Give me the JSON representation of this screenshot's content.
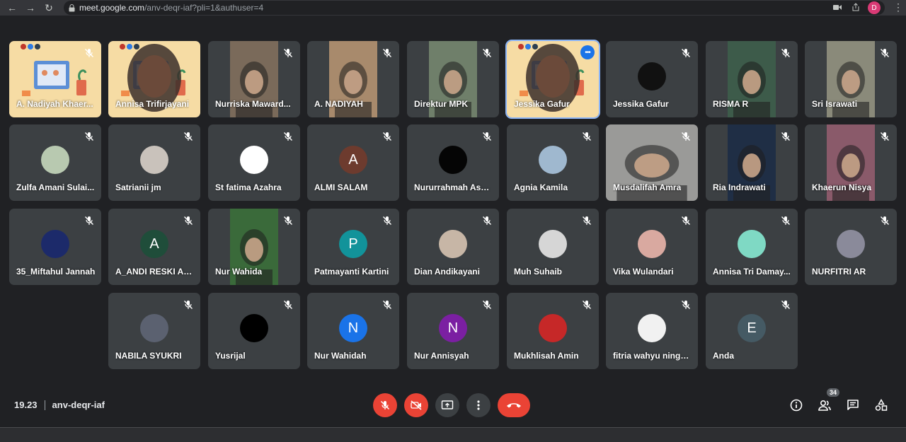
{
  "browser": {
    "url_host": "meet.google.com",
    "url_path": "/anv-deqr-iaf?pli=1&authuser=4",
    "profile_initial": "D",
    "icons": [
      "back-icon",
      "forward-icon",
      "reload-icon",
      "lock-icon",
      "camera-icon",
      "share-icon",
      "star-icon",
      "menu-icon"
    ]
  },
  "participants": [
    {
      "name": "A. Nadiyah Khaer...",
      "kind": "screen",
      "muted": true
    },
    {
      "name": "Annisa Trifirjayani",
      "kind": "screen-cam",
      "muted": false
    },
    {
      "name": "Nurriska Maward...",
      "kind": "video",
      "muted": true,
      "tone": "#7a6a5a"
    },
    {
      "name": "A. NADIYAH",
      "kind": "video",
      "muted": true,
      "tone": "#a88a6c"
    },
    {
      "name": "Direktur MPK",
      "kind": "video",
      "muted": true,
      "tone": "#6f7f6a"
    },
    {
      "name": "Jessika Gafur",
      "kind": "screen-cam",
      "muted": false,
      "active": true,
      "more": "•••"
    },
    {
      "name": "Jessika Gafur",
      "kind": "avatar",
      "muted": true,
      "color": "#111111",
      "initial": ""
    },
    {
      "name": "RISMA R",
      "kind": "video",
      "muted": true,
      "tone": "#3d5b4a"
    },
    {
      "name": "Sri Israwati",
      "kind": "video",
      "muted": true,
      "tone": "#8a8a7a"
    },
    {
      "name": "Zulfa Amani Sulai...",
      "kind": "avatar",
      "muted": true,
      "color": "#b8c9b0",
      "initial": ""
    },
    {
      "name": "Satrianii jm",
      "kind": "avatar",
      "muted": true,
      "color": "#c9c2bb",
      "initial": ""
    },
    {
      "name": "St fatima Azahra",
      "kind": "avatar",
      "muted": true,
      "color": "#ffffff",
      "initial": ""
    },
    {
      "name": "ALMI SALAM",
      "kind": "avatar",
      "muted": true,
      "color": "#6d3b2e",
      "initial": "A"
    },
    {
      "name": "Nururrahmah Ashar",
      "kind": "avatar",
      "muted": true,
      "color": "#050505",
      "initial": ""
    },
    {
      "name": "Agnia Kamila",
      "kind": "avatar",
      "muted": true,
      "color": "#9fb8cf",
      "initial": ""
    },
    {
      "name": "Musdalifah Amra",
      "kind": "video",
      "muted": true,
      "wide": true,
      "tone": "#9a9a98"
    },
    {
      "name": "Ria Indrawati",
      "kind": "video",
      "muted": true,
      "tone": "#1f2e45"
    },
    {
      "name": "Khaerun Nisya",
      "kind": "video",
      "muted": true,
      "tone": "#8a5a6a"
    },
    {
      "name": "35_Miftahul Jannah",
      "kind": "avatar",
      "muted": true,
      "color": "#1c2a6a",
      "initial": ""
    },
    {
      "name": "A_ANDI RESKI AN...",
      "kind": "avatar",
      "muted": true,
      "color": "#1f4d3a",
      "initial": "A"
    },
    {
      "name": "Nur Wahida",
      "kind": "video",
      "muted": true,
      "tone": "#3a6a3a"
    },
    {
      "name": "Patmayanti Kartini",
      "kind": "avatar",
      "muted": true,
      "color": "#12939a",
      "initial": "P"
    },
    {
      "name": "Dian Andikayani",
      "kind": "avatar",
      "muted": true,
      "color": "#c7b6a6",
      "initial": ""
    },
    {
      "name": "Muh Suhaib",
      "kind": "avatar",
      "muted": true,
      "color": "#d6d6d6",
      "initial": ""
    },
    {
      "name": "Vika Wulandari",
      "kind": "avatar",
      "muted": true,
      "color": "#d9a9a0",
      "initial": ""
    },
    {
      "name": "Annisa Tri Damay...",
      "kind": "avatar",
      "muted": true,
      "color": "#7fd9c4",
      "initial": ""
    },
    {
      "name": "NURFITRI AR",
      "kind": "avatar",
      "muted": true,
      "color": "#8a8a9a",
      "initial": ""
    },
    {
      "name": "NABILA SYUKRI",
      "kind": "avatar",
      "muted": true,
      "color": "#5b6170",
      "initial": ""
    },
    {
      "name": "Yusrijal",
      "kind": "avatar",
      "muted": true,
      "color": "#000000",
      "initial": ""
    },
    {
      "name": "Nur Wahidah",
      "kind": "avatar",
      "muted": true,
      "color": "#1a73e8",
      "initial": "N"
    },
    {
      "name": "Nur Annisyah",
      "kind": "avatar",
      "muted": true,
      "color": "#7b1fa2",
      "initial": "N"
    },
    {
      "name": "Mukhlisah Amin",
      "kind": "avatar",
      "muted": true,
      "color": "#c62828",
      "initial": ""
    },
    {
      "name": "fitria wahyu ningsih",
      "kind": "avatar",
      "muted": true,
      "color": "#f1f1f1",
      "initial": ""
    },
    {
      "name": "Anda",
      "kind": "avatar",
      "muted": true,
      "color": "#455a64",
      "initial": "E"
    }
  ],
  "meeting": {
    "time": "19.23",
    "code": "anv-deqr-iaf",
    "participant_count": "34"
  },
  "colors": {
    "end_call": "#ea4335",
    "active_border": "#8ab4f8",
    "tile": "#3c4043",
    "background": "#202124"
  }
}
